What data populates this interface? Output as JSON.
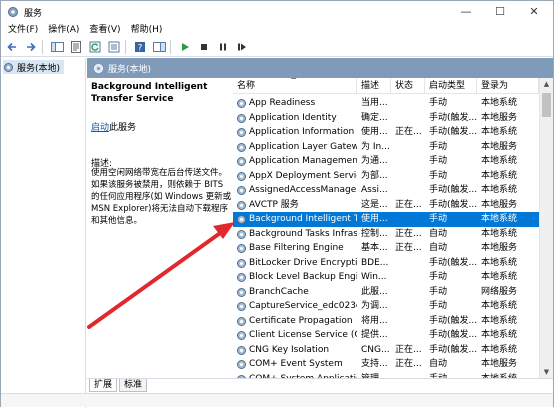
{
  "window": {
    "title": "服务",
    "controls": {
      "minimize": "—",
      "maximize": "☐",
      "close": "✕"
    }
  },
  "menu": [
    "文件(F)",
    "操作(A)",
    "查看(V)",
    "帮助(H)"
  ],
  "toolbar": {
    "icons": [
      "back-arrow-icon",
      "forward-arrow-icon",
      "console-tree-icon",
      "properties-icon",
      "refresh-icon",
      "export-list-icon",
      "help-icon",
      "show-hide-icon",
      "start-icon",
      "stop-icon",
      "pause-icon",
      "restart-icon"
    ]
  },
  "tree": {
    "item": "服务(本地)"
  },
  "header": {
    "label": "服务(本地)"
  },
  "description_pane": {
    "title": "Background Intelligent Transfer Service",
    "link": "启动",
    "link_suffix": "此服务",
    "desc_label": "描述:",
    "desc_text": "使用空闲网络带宽在后台传送文件。如果该服务被禁用，则依赖于 BITS 的任何应用程序(如 Windows 更新或 MSN Explorer)将无法自动下载程序和其他信息。"
  },
  "grid": {
    "columns": [
      "名称",
      "描述",
      "状态",
      "启动类型",
      "登录为"
    ],
    "rows": [
      {
        "name": "App Readiness",
        "desc": "当用...",
        "status": "",
        "startup": "手动",
        "logon": "本地系统"
      },
      {
        "name": "Application Identity",
        "desc": "确定...",
        "status": "",
        "startup": "手动(触发...",
        "logon": "本地服务"
      },
      {
        "name": "Application Information",
        "desc": "使用...",
        "status": "正在...",
        "startup": "手动(触发...",
        "logon": "本地系统"
      },
      {
        "name": "Application Layer Gatewa...",
        "desc": "为 In...",
        "status": "",
        "startup": "手动",
        "logon": "本地服务"
      },
      {
        "name": "Application Management",
        "desc": "为通...",
        "status": "",
        "startup": "手动",
        "logon": "本地系统"
      },
      {
        "name": "AppX Deployment Servic...",
        "desc": "为部...",
        "status": "",
        "startup": "手动",
        "logon": "本地系统"
      },
      {
        "name": "AssignedAccessManager...",
        "desc": "Assi...",
        "status": "",
        "startup": "手动(触发...",
        "logon": "本地系统"
      },
      {
        "name": "AVCTP 服务",
        "desc": "这是...",
        "status": "正在...",
        "startup": "手动(触发...",
        "logon": "本地服务"
      },
      {
        "name": "Background Intelligent T...",
        "desc": "使用...",
        "status": "",
        "startup": "手动",
        "logon": "本地系统"
      },
      {
        "name": "Background Tasks Infras...",
        "desc": "控制...",
        "status": "正在...",
        "startup": "自动",
        "logon": "本地系统"
      },
      {
        "name": "Base Filtering Engine",
        "desc": "基本...",
        "status": "正在...",
        "startup": "自动",
        "logon": "本地服务"
      },
      {
        "name": "BitLocker Drive Encryptio...",
        "desc": "BDE...",
        "status": "",
        "startup": "手动(触发...",
        "logon": "本地系统"
      },
      {
        "name": "Block Level Backup Engi...",
        "desc": "Win...",
        "status": "",
        "startup": "手动",
        "logon": "本地系统"
      },
      {
        "name": "BranchCache",
        "desc": "此服...",
        "status": "",
        "startup": "手动",
        "logon": "网络服务"
      },
      {
        "name": "CaptureService_edc023e",
        "desc": "为调...",
        "status": "",
        "startup": "手动",
        "logon": "本地系统"
      },
      {
        "name": "Certificate Propagation",
        "desc": "将用...",
        "status": "",
        "startup": "手动(触发...",
        "logon": "本地系统"
      },
      {
        "name": "Client License Service (Cli...",
        "desc": "提供...",
        "status": "",
        "startup": "手动(触发...",
        "logon": "本地系统"
      },
      {
        "name": "CNG Key Isolation",
        "desc": "CNG...",
        "status": "正在...",
        "startup": "手动(触发...",
        "logon": "本地系统"
      },
      {
        "name": "COM+ Event System",
        "desc": "支持...",
        "status": "正在...",
        "startup": "自动",
        "logon": "本地服务"
      },
      {
        "name": "COM+ System Application",
        "desc": "管理...",
        "status": "",
        "startup": "手动",
        "logon": "本地系统"
      }
    ],
    "selected_index": 8
  },
  "tabs": [
    "扩展",
    "标准"
  ],
  "colors": {
    "selection": "#0078d7",
    "header_band": "#7f9bb9",
    "arrow": "#e1282d",
    "link": "#0b57a8"
  }
}
